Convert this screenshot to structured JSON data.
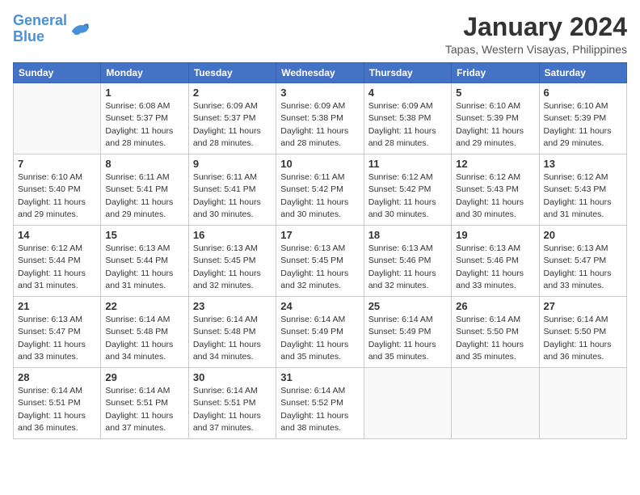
{
  "logo": {
    "text_general": "General",
    "text_blue": "Blue"
  },
  "title": "January 2024",
  "location": "Tapas, Western Visayas, Philippines",
  "days_of_week": [
    "Sunday",
    "Monday",
    "Tuesday",
    "Wednesday",
    "Thursday",
    "Friday",
    "Saturday"
  ],
  "weeks": [
    [
      {
        "day": "",
        "sunrise": "",
        "sunset": "",
        "daylight": "",
        "empty": true
      },
      {
        "day": "1",
        "sunrise": "6:08 AM",
        "sunset": "5:37 PM",
        "daylight": "11 hours and 28 minutes."
      },
      {
        "day": "2",
        "sunrise": "6:09 AM",
        "sunset": "5:37 PM",
        "daylight": "11 hours and 28 minutes."
      },
      {
        "day": "3",
        "sunrise": "6:09 AM",
        "sunset": "5:38 PM",
        "daylight": "11 hours and 28 minutes."
      },
      {
        "day": "4",
        "sunrise": "6:09 AM",
        "sunset": "5:38 PM",
        "daylight": "11 hours and 28 minutes."
      },
      {
        "day": "5",
        "sunrise": "6:10 AM",
        "sunset": "5:39 PM",
        "daylight": "11 hours and 29 minutes."
      },
      {
        "day": "6",
        "sunrise": "6:10 AM",
        "sunset": "5:39 PM",
        "daylight": "11 hours and 29 minutes."
      }
    ],
    [
      {
        "day": "7",
        "sunrise": "6:10 AM",
        "sunset": "5:40 PM",
        "daylight": "11 hours and 29 minutes."
      },
      {
        "day": "8",
        "sunrise": "6:11 AM",
        "sunset": "5:41 PM",
        "daylight": "11 hours and 29 minutes."
      },
      {
        "day": "9",
        "sunrise": "6:11 AM",
        "sunset": "5:41 PM",
        "daylight": "11 hours and 30 minutes."
      },
      {
        "day": "10",
        "sunrise": "6:11 AM",
        "sunset": "5:42 PM",
        "daylight": "11 hours and 30 minutes."
      },
      {
        "day": "11",
        "sunrise": "6:12 AM",
        "sunset": "5:42 PM",
        "daylight": "11 hours and 30 minutes."
      },
      {
        "day": "12",
        "sunrise": "6:12 AM",
        "sunset": "5:43 PM",
        "daylight": "11 hours and 30 minutes."
      },
      {
        "day": "13",
        "sunrise": "6:12 AM",
        "sunset": "5:43 PM",
        "daylight": "11 hours and 31 minutes."
      }
    ],
    [
      {
        "day": "14",
        "sunrise": "6:12 AM",
        "sunset": "5:44 PM",
        "daylight": "11 hours and 31 minutes."
      },
      {
        "day": "15",
        "sunrise": "6:13 AM",
        "sunset": "5:44 PM",
        "daylight": "11 hours and 31 minutes."
      },
      {
        "day": "16",
        "sunrise": "6:13 AM",
        "sunset": "5:45 PM",
        "daylight": "11 hours and 32 minutes."
      },
      {
        "day": "17",
        "sunrise": "6:13 AM",
        "sunset": "5:45 PM",
        "daylight": "11 hours and 32 minutes."
      },
      {
        "day": "18",
        "sunrise": "6:13 AM",
        "sunset": "5:46 PM",
        "daylight": "11 hours and 32 minutes."
      },
      {
        "day": "19",
        "sunrise": "6:13 AM",
        "sunset": "5:46 PM",
        "daylight": "11 hours and 33 minutes."
      },
      {
        "day": "20",
        "sunrise": "6:13 AM",
        "sunset": "5:47 PM",
        "daylight": "11 hours and 33 minutes."
      }
    ],
    [
      {
        "day": "21",
        "sunrise": "6:13 AM",
        "sunset": "5:47 PM",
        "daylight": "11 hours and 33 minutes."
      },
      {
        "day": "22",
        "sunrise": "6:14 AM",
        "sunset": "5:48 PM",
        "daylight": "11 hours and 34 minutes."
      },
      {
        "day": "23",
        "sunrise": "6:14 AM",
        "sunset": "5:48 PM",
        "daylight": "11 hours and 34 minutes."
      },
      {
        "day": "24",
        "sunrise": "6:14 AM",
        "sunset": "5:49 PM",
        "daylight": "11 hours and 35 minutes."
      },
      {
        "day": "25",
        "sunrise": "6:14 AM",
        "sunset": "5:49 PM",
        "daylight": "11 hours and 35 minutes."
      },
      {
        "day": "26",
        "sunrise": "6:14 AM",
        "sunset": "5:50 PM",
        "daylight": "11 hours and 35 minutes."
      },
      {
        "day": "27",
        "sunrise": "6:14 AM",
        "sunset": "5:50 PM",
        "daylight": "11 hours and 36 minutes."
      }
    ],
    [
      {
        "day": "28",
        "sunrise": "6:14 AM",
        "sunset": "5:51 PM",
        "daylight": "11 hours and 36 minutes."
      },
      {
        "day": "29",
        "sunrise": "6:14 AM",
        "sunset": "5:51 PM",
        "daylight": "11 hours and 37 minutes."
      },
      {
        "day": "30",
        "sunrise": "6:14 AM",
        "sunset": "5:51 PM",
        "daylight": "11 hours and 37 minutes."
      },
      {
        "day": "31",
        "sunrise": "6:14 AM",
        "sunset": "5:52 PM",
        "daylight": "11 hours and 38 minutes."
      },
      {
        "day": "",
        "sunrise": "",
        "sunset": "",
        "daylight": "",
        "empty": true
      },
      {
        "day": "",
        "sunrise": "",
        "sunset": "",
        "daylight": "",
        "empty": true
      },
      {
        "day": "",
        "sunrise": "",
        "sunset": "",
        "daylight": "",
        "empty": true
      }
    ]
  ]
}
